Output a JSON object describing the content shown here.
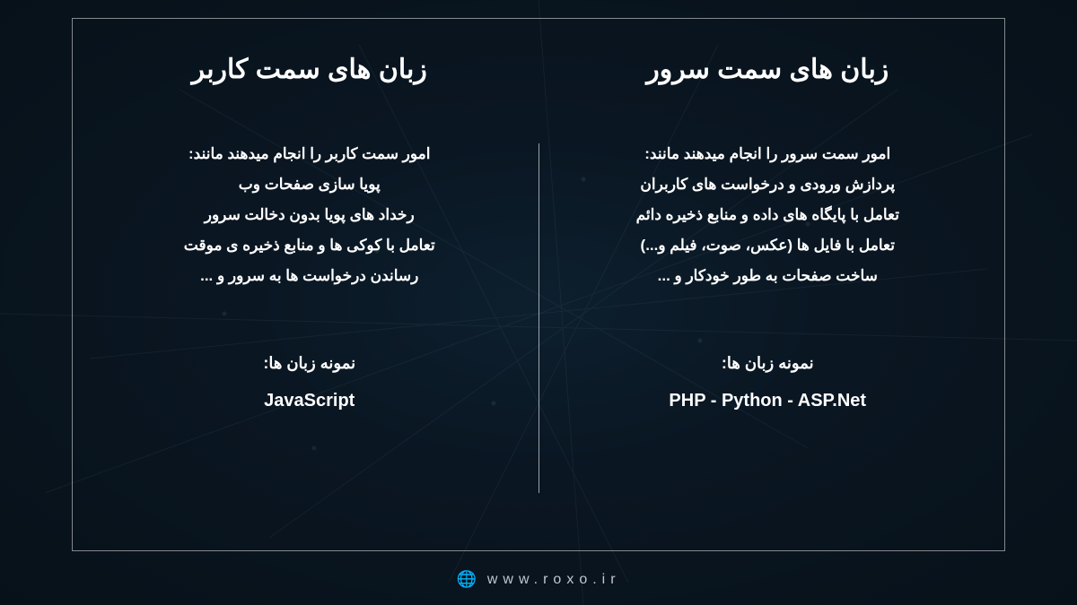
{
  "left": {
    "title": "زبان های سمت کاربر",
    "lines": [
      "امور سمت کاربر را انجام میدهند مانند:",
      "پویا سازی صفحات وب",
      "رخداد های پویا بدون دخالت سرور",
      "تعامل با کوکی ها و منابع ذخیره ی موقت",
      "رساندن درخواست ها به سرور و ..."
    ],
    "examples_label": "نمونه زبان ها:",
    "examples": "JavaScript"
  },
  "right": {
    "title": "زبان های سمت سرور",
    "lines": [
      "امور سمت سرور را انجام میدهند مانند:",
      "پردازش ورودی و درخواست های کاربران",
      "تعامل با پایگاه های داده و منابع ذخیره دائم",
      "تعامل با فایل ها (عکس، صوت، فیلم و...)",
      "ساخت صفحات به طور خودکار و ..."
    ],
    "examples_label": "نمونه زبان ها:",
    "examples": "PHP - Python - ASP.Net"
  },
  "footer": {
    "url": "www.roxo.ir",
    "globe": "🌐"
  }
}
